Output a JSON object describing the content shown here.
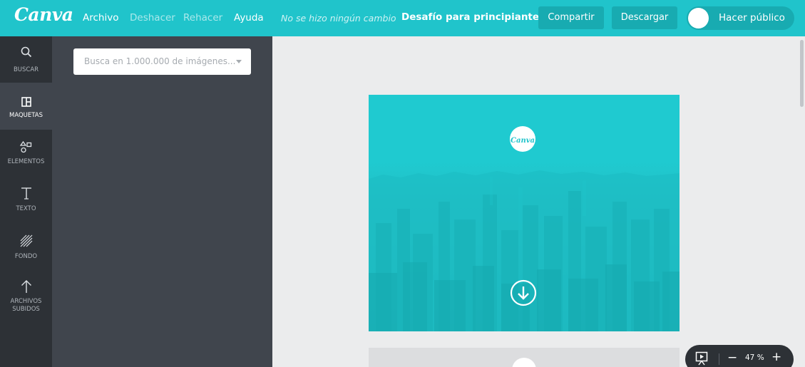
{
  "brand": {
    "logo": "Canva",
    "accent": "#20c4cb",
    "dark": "#2d3136",
    "panel": "#40454d"
  },
  "menu": {
    "file": "Archivo",
    "undo": "Deshacer",
    "redo": "Rehacer",
    "help": "Ayuda"
  },
  "status": "No se hizo ningún cambio",
  "document_title": "Desafío para principiantes",
  "actions": {
    "share": "Compartir",
    "download": "Descargar",
    "publish": "Hacer público"
  },
  "rail": [
    {
      "label": "BUSCAR",
      "icon": "search-icon"
    },
    {
      "label": "MAQUETAS",
      "icon": "layout-icon"
    },
    {
      "label": "ELEMENTOS",
      "icon": "shapes-icon"
    },
    {
      "label": "TEXTO",
      "icon": "text-icon"
    },
    {
      "label": "FONDO",
      "icon": "background-icon"
    },
    {
      "label": "ARCHIVOS",
      "label2": "SUBIDOS",
      "icon": "upload-icon"
    }
  ],
  "search": {
    "placeholder": "Busca en 1.000.000 de imágenes..."
  },
  "design": {
    "logo": "Canva",
    "color": "#1ecad0"
  },
  "zoom": {
    "value": "47 %",
    "minus": "−",
    "plus": "+"
  }
}
